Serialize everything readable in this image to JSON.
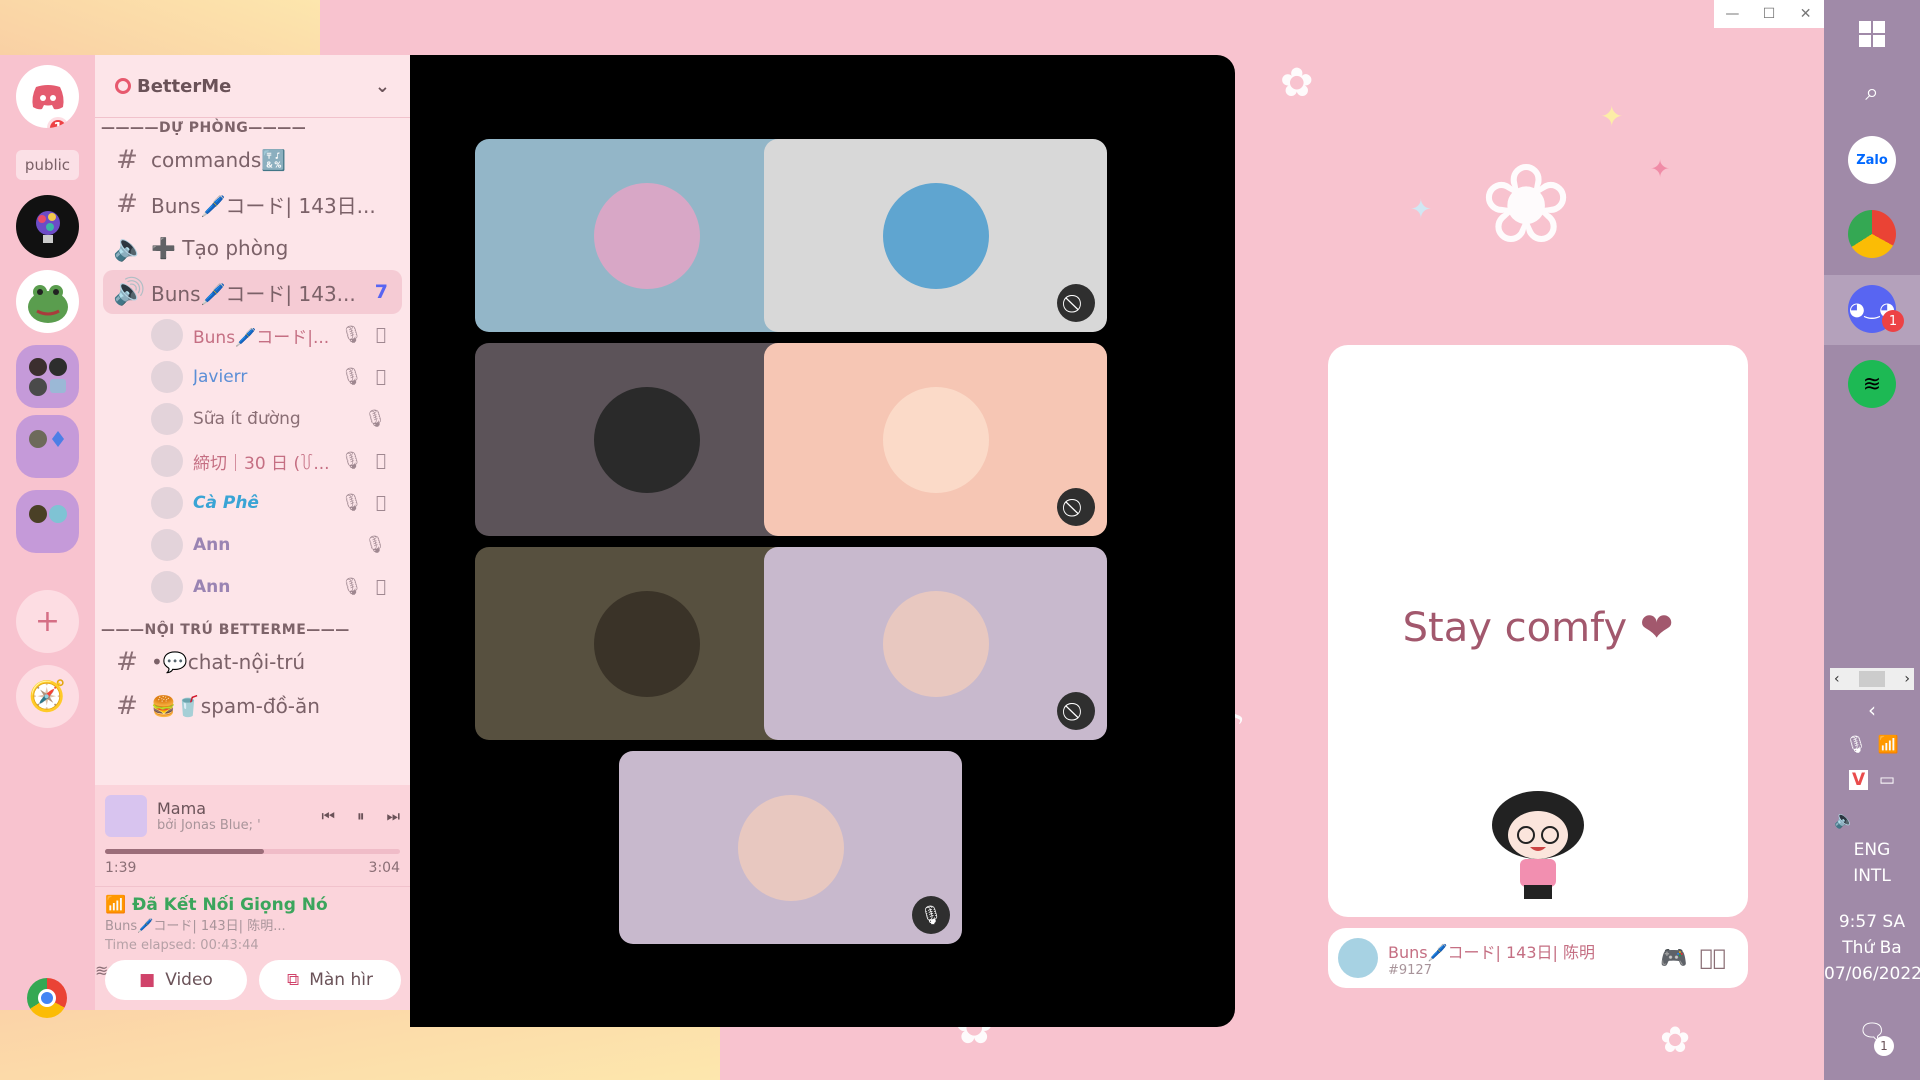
{
  "guild": {
    "name": "BetterMe"
  },
  "server_rail": {
    "public_label": "public",
    "discord_badge": "1"
  },
  "categories": [
    {
      "label": "————DỰ PHÒNG————"
    },
    {
      "label": "———NỘI TRÚ BETTERME———"
    }
  ],
  "channels_top": [
    {
      "icon": "#",
      "label": "commands🔣"
    },
    {
      "icon": "#",
      "label": "Buns🖊️コード| 143日..."
    },
    {
      "icon": "🔈",
      "label": "➕ Tạo phòng"
    }
  ],
  "active_voice": {
    "label": "Buns🖊️コード| 143...",
    "count": "7"
  },
  "voice_users": [
    {
      "name": "Buns🖊️コード|...",
      "icons": "🎙 ⃠"
    },
    {
      "name": "Javierr",
      "icons": "🎙 ⃠"
    },
    {
      "name": "Sữa ít đường",
      "icons": "🎙"
    },
    {
      "name": "締切｜30 日 (꒦...",
      "icons": "🎙 ⃠"
    },
    {
      "name": "Cà Phê",
      "icons": "🎙 ⃠"
    },
    {
      "name": "Ann",
      "icons": "🎙"
    },
    {
      "name": "Ann",
      "icons": "🎙 ⃠"
    }
  ],
  "channels_bottom": [
    {
      "icon": "#",
      "label": "•💬chat-nội-trú"
    },
    {
      "icon": "#",
      "label": "🍔🥤spam-đồ-ăn"
    }
  ],
  "music": {
    "title": "Mama",
    "artist": "bởi Jonas Blue; '",
    "elapsed": "1:39",
    "total": "3:04",
    "progress": 0.54
  },
  "voice_panel": {
    "status": "Đã Kết Nối Giọng Nó",
    "channel": "Buns🖊️コード| 143日| 陈明...",
    "elapsed": "Time elapsed: 00:43:44",
    "video_label": "Video",
    "screen_label": "Màn hìr"
  },
  "stage_tiles": [
    {
      "bg": "#93b6c8",
      "avatar": "#d8a7c6",
      "muted": "video-off"
    },
    {
      "bg": "#d8d8d8",
      "avatar": "#5fa5d0",
      "muted": "video-off"
    },
    {
      "bg": "#5c5359",
      "avatar": "#2a2a2a",
      "muted": "mic-off"
    },
    {
      "bg": "#f6c6b4",
      "avatar": "#fbdac8",
      "muted": "video-off"
    },
    {
      "bg": "#57503f",
      "avatar": "#3a3328",
      "muted": "video-off"
    },
    {
      "bg": "#c8b9cd",
      "avatar": "#e8c8c0",
      "muted": "video-off"
    },
    {
      "bg": "#c8b9cd",
      "avatar": "#e8c8c0",
      "muted": "mic-off"
    }
  ],
  "widget": {
    "text": "Stay comfy ❤"
  },
  "userbar": {
    "name": "Buns🖊️コード| 143日| 陈明",
    "tag": "#9127"
  },
  "taskbar": {
    "apps": [
      "Zalo",
      "Chrome",
      "Discord",
      "Spotify"
    ],
    "discord_badge": "1",
    "lang1": "ENG",
    "lang2": "INTL",
    "time": "9:57 SA",
    "day": "Thứ Ba",
    "date": "07/06/2022",
    "notif_badge": "1"
  },
  "colors": {
    "accent": "#5865f2",
    "connected": "#3ba55c",
    "pink_bg": "#f8c3cf"
  }
}
